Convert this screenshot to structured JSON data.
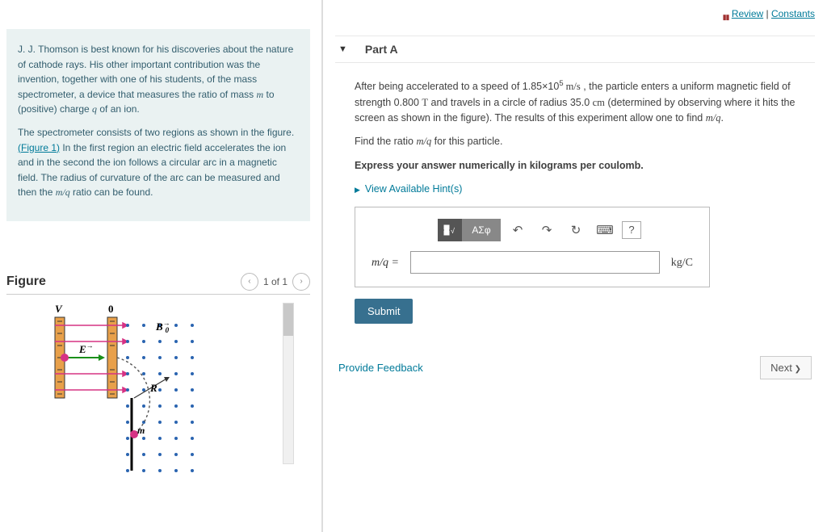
{
  "top_links": {
    "review": "Review",
    "separator": " | ",
    "constants": "Constants"
  },
  "description": {
    "para1_a": "J. J. Thomson is best known for his discoveries about the nature of cathode rays. His other important contribution was the invention, together with one of his students, of the mass spectrometer, a device that measures the ratio of mass ",
    "m": "m",
    "para1_b": " to (positive) charge ",
    "q": "q",
    "para1_c": " of an ion.",
    "para2_a": "The spectrometer consists of two regions as shown in the figure.",
    "fig_link": "(Figure 1)",
    "para2_b": " In the first region an electric field accelerates the ion and in the second the ion follows a circular arc in a magnetic field. The radius of curvature of the arc can be measured and then the ",
    "mq": "m/q",
    "para2_c": " ratio can be found."
  },
  "figure": {
    "heading": "Figure",
    "pager_text": "1 of 1",
    "labels": {
      "V": "V",
      "zero": "0",
      "E": "E",
      "B0": "B",
      "B0_sub": "0",
      "R": "R",
      "m": "m"
    }
  },
  "part": {
    "label": "Part A"
  },
  "problem": {
    "p1_a": "After being accelerated to a speed of 1.85×10",
    "p1_exp": "5",
    "p1_unit": " m/s",
    "p1_b": " , the particle enters a uniform magnetic field of strength 0.800 ",
    "p1_T": "T",
    "p1_c": " and travels in a circle of radius 35.0 ",
    "p1_cm": "cm",
    "p1_d": " (determined by observing where it hits the screen as shown in the figure). The results of this experiment allow one to find ",
    "p1_mq": "m/q",
    "p1_e": ".",
    "p2_a": "Find the ratio ",
    "p2_mq": "m/q",
    "p2_b": " for this particle.",
    "instruct": "Express your answer numerically in kilograms per coulomb.",
    "hints": "View Available Hint(s)"
  },
  "toolbar": {
    "greek": "ΑΣφ",
    "undo": "↶",
    "redo": "↷",
    "reset": "↻",
    "keyboard": "⌨",
    "help": "?"
  },
  "answer": {
    "label": "m/q =",
    "value": "",
    "unit": "kg/C",
    "submit": "Submit"
  },
  "footer": {
    "feedback": "Provide Feedback",
    "next": "Next"
  }
}
